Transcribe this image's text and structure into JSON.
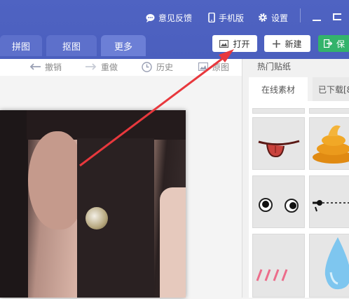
{
  "titlebar": {
    "feedback_label": "意见反馈",
    "mobile_label": "手机版",
    "settings_label": "设置"
  },
  "tabs": [
    {
      "label": "拼图"
    },
    {
      "label": "抠图"
    },
    {
      "label": "更多"
    }
  ],
  "actions": {
    "open_label": "打开",
    "new_label": "新建",
    "save_label": "保"
  },
  "toolbar": {
    "undo_label": "撤销",
    "redo_label": "重做",
    "history_label": "历史",
    "original_label": "原图"
  },
  "sticker_panel": {
    "title": "热门贴纸",
    "tab_online": "在线素材",
    "tab_downloaded": "已下载[8"
  },
  "colors": {
    "titlebar": "#4f63c2",
    "save_button": "#33b36b",
    "annotation_arrow": "#e8383d"
  },
  "stickers": [
    "tongue-sticker",
    "poop-sticker",
    "eyes-sticker",
    "drip-sticker",
    "lines-sticker",
    "drop-sticker"
  ]
}
